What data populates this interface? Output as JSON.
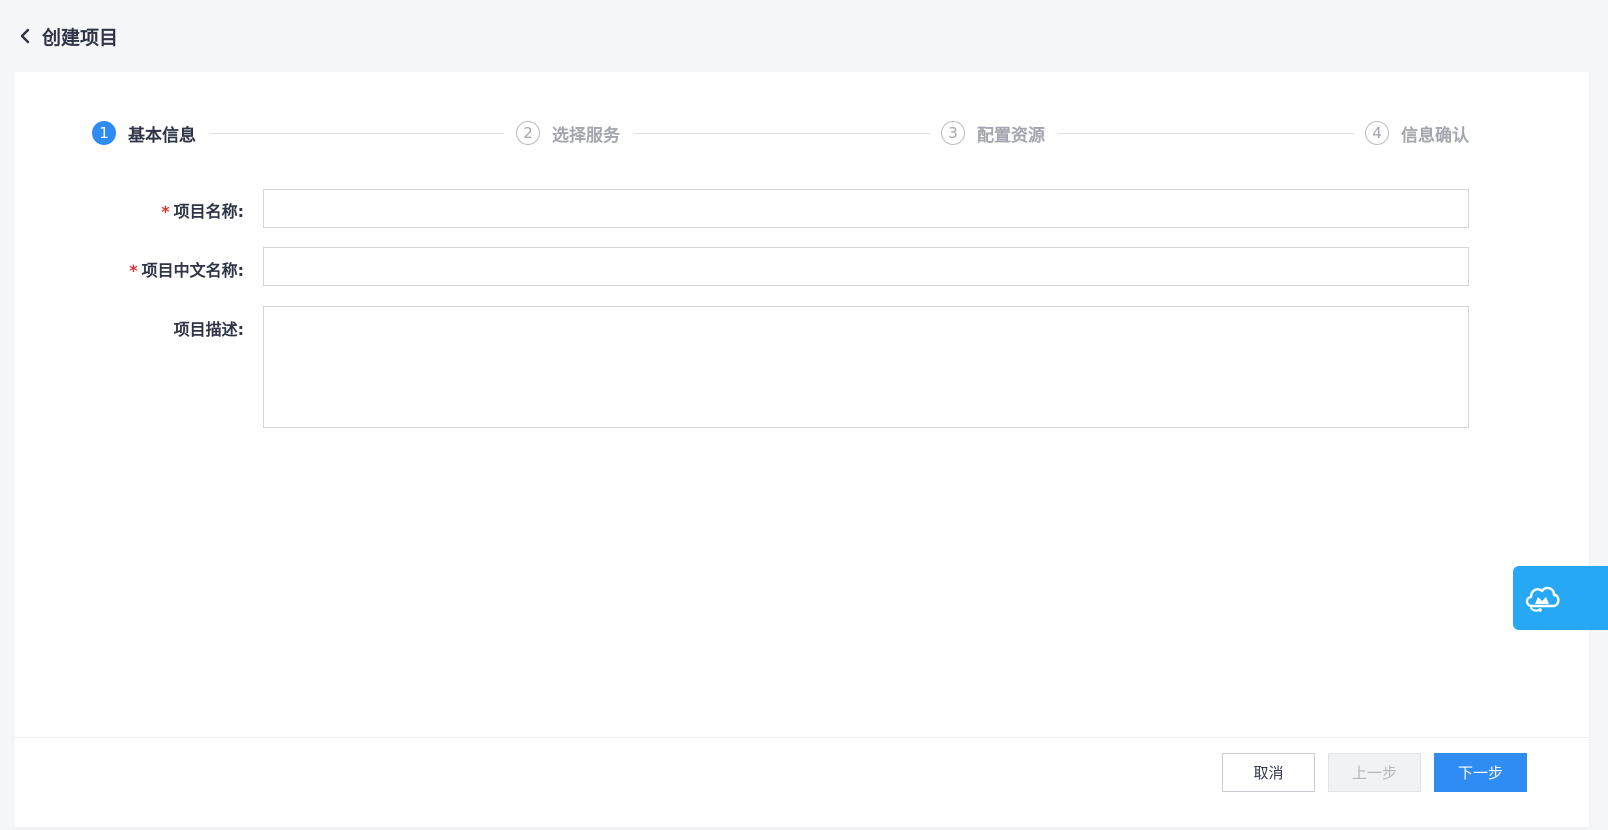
{
  "header": {
    "title": "创建项目",
    "back_icon": "chevron-left-icon"
  },
  "steps": [
    {
      "number": "1",
      "label": "基本信息",
      "state": "active"
    },
    {
      "number": "2",
      "label": "选择服务",
      "state": "pending"
    },
    {
      "number": "3",
      "label": "配置资源",
      "state": "pending"
    },
    {
      "number": "4",
      "label": "信息确认",
      "state": "pending"
    }
  ],
  "form": {
    "name": {
      "label": "项目名称:",
      "required_mark": "*",
      "value": ""
    },
    "chinese_name": {
      "label": "项目中文名称:",
      "required_mark": "*",
      "value": ""
    },
    "description": {
      "label": "项目描述:",
      "value": ""
    }
  },
  "footer": {
    "cancel_label": "取消",
    "prev_label": "上一步",
    "next_label": "下一步"
  },
  "assistant": {
    "icon": "cloud-assistant-icon"
  },
  "colors": {
    "accent": "#2f8cf3",
    "required": "#e0302d",
    "assistant": "#27a8f5",
    "background": "#f5f6f8"
  }
}
